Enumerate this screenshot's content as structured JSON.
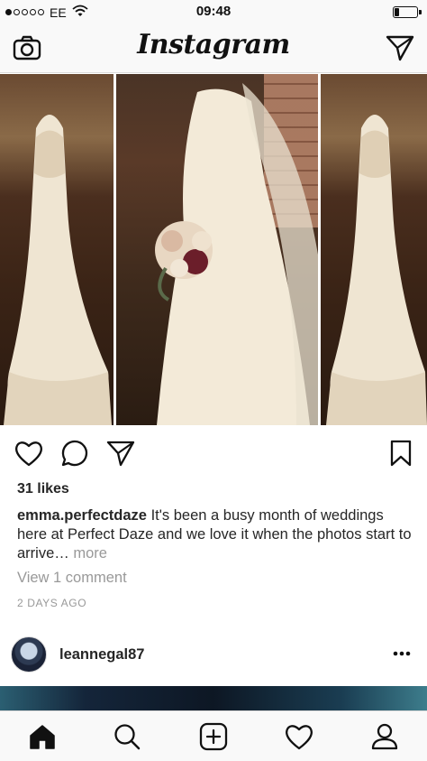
{
  "status_bar": {
    "carrier": "EE",
    "time": "09:48",
    "signal_bars_filled": 1,
    "signal_bars_total": 5,
    "battery_level": 0.2
  },
  "header": {
    "logo_text": "Instagram",
    "left_icon": "camera-icon",
    "right_icon": "direct-message-icon"
  },
  "post": {
    "actions": [
      "heart-icon",
      "comment-icon",
      "share-icon",
      "bookmark-icon"
    ],
    "likes": "31 likes",
    "caption_user": "emma.perfectdaze",
    "caption_text": " It's been a busy month of weddings here at Perfect Daze and we love it when the photos start to arrive…",
    "caption_more": " more",
    "view_comments": "View 1 comment",
    "timestamp": "2 DAYS AGO"
  },
  "next_post": {
    "username": "leannegal87",
    "menu_icon": "more-options-icon"
  },
  "tab_bar": {
    "items": [
      "home-icon",
      "search-icon",
      "new-post-icon",
      "activity-heart-icon",
      "profile-icon"
    ],
    "active": "home-icon"
  },
  "colors": {
    "text": "#262626",
    "secondary": "#999999",
    "bar_background": "#f9f9f9",
    "border": "#dbdbdb"
  }
}
